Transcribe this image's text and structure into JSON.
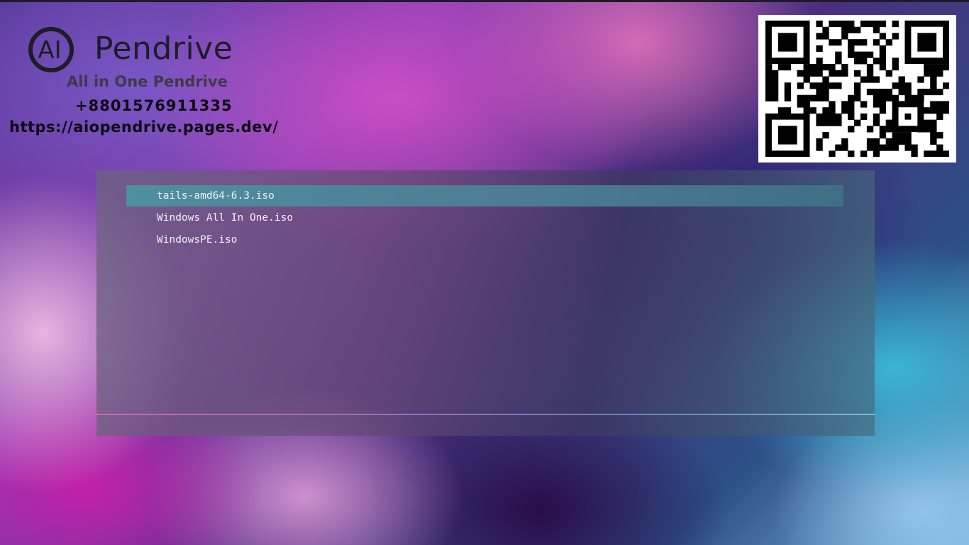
{
  "branding": {
    "logo_text": "AI",
    "title": "Pendrive",
    "tagline": "All in One Pendrive",
    "phone": "+8801576911335",
    "url": "https://aiopendrive.pages.dev/"
  },
  "qr_code": {
    "icon": "qr-code"
  },
  "boot_menu": {
    "selected_index": 0,
    "items": [
      {
        "label": "tails-amd64-6.3.iso"
      },
      {
        "label": "Windows All In One.iso"
      },
      {
        "label": "WindowsPE.iso"
      }
    ],
    "status_text": ""
  },
  "colors": {
    "selection": "#4f8f9f",
    "panel": "#6e6482",
    "menu_text": "#f2f0f6",
    "logo": "#1d1d28"
  }
}
